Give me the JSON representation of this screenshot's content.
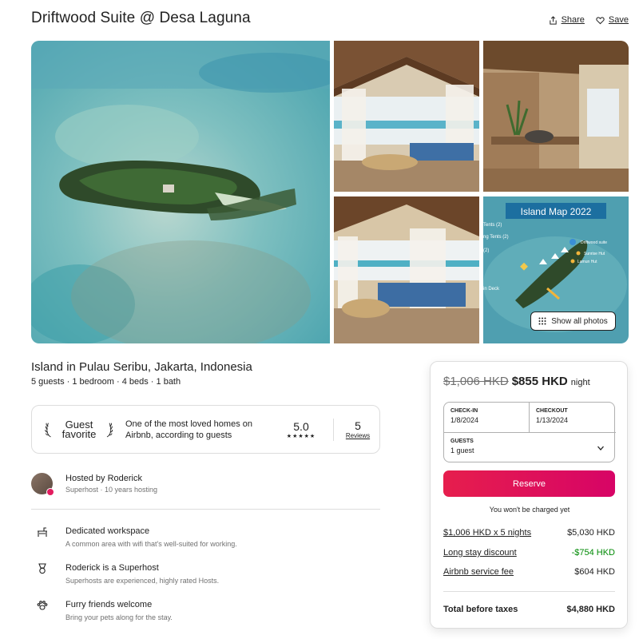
{
  "listing": {
    "title": "Driftwood Suite @ Desa Laguna",
    "location": "Island in Pulau Seribu, Jakarta, Indonesia",
    "specs": "5 guests · 1 bedroom · 4 beds · 1 bath"
  },
  "actions": {
    "share": "Share",
    "save": "Save"
  },
  "gallery": {
    "show_all": "Show all photos",
    "map_title": "Island Map 2022",
    "map_labels": [
      "Tents (2)",
      "ng Tents (2)",
      "(2)",
      "in Deck",
      "Driftwood suite",
      "Sunrise Hut",
      "Lamun Hut"
    ]
  },
  "favorite": {
    "badge": "Guest favorite",
    "description": "One of the most loved homes on Airbnb, according to guests",
    "rating": "5.0",
    "stars": "★★★★★",
    "reviews_count": "5",
    "reviews_label": "Reviews"
  },
  "host": {
    "name": "Hosted by Roderick",
    "sub": "Superhost · 10 years hosting"
  },
  "features": [
    {
      "title": "Dedicated workspace",
      "sub": "A common area with wifi that's well-suited for working.",
      "icon": "desk-icon"
    },
    {
      "title": "Roderick is a Superhost",
      "sub": "Superhosts are experienced, highly rated Hosts.",
      "icon": "medal-icon"
    },
    {
      "title": "Furry friends welcome",
      "sub": "Bring your pets along for the stay.",
      "icon": "paw-icon"
    }
  ],
  "booking": {
    "price_old": "$1,006 HKD",
    "price_new": "$855 HKD",
    "price_unit": "night",
    "checkin_label": "CHECK-IN",
    "checkin_value": "1/8/2024",
    "checkout_label": "CHECKOUT",
    "checkout_value": "1/13/2024",
    "guests_label": "GUESTS",
    "guests_value": "1 guest",
    "reserve": "Reserve",
    "no_charge": "You won't be charged yet",
    "lines": [
      {
        "label": "$1,006 HKD x 5 nights",
        "value": "$5,030 HKD"
      },
      {
        "label": "Long stay discount",
        "value": "-$754 HKD"
      },
      {
        "label": "Airbnb service fee",
        "value": "$604 HKD"
      }
    ],
    "total_label": "Total before taxes",
    "total_value": "$4,880 HKD"
  },
  "colors": {
    "accent": "#e61e4d",
    "discount": "#008a05",
    "muted": "#717171"
  }
}
